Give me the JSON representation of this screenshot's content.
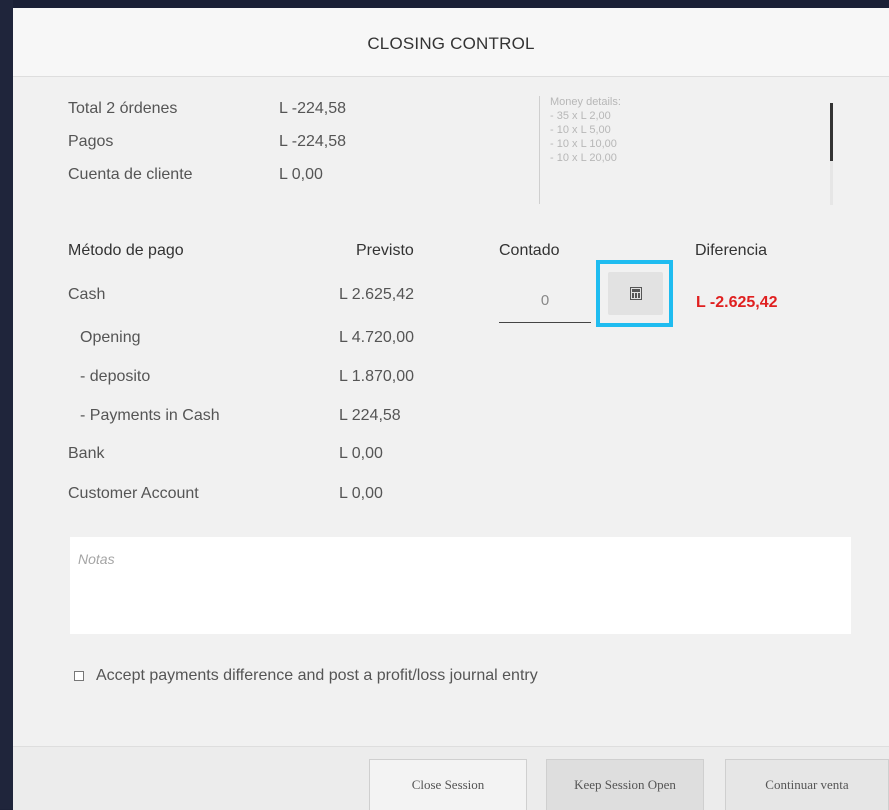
{
  "dialog": {
    "title": "CLOSING CONTROL"
  },
  "summary": [
    {
      "label": "Total 2 órdenes",
      "value": "L -224,58"
    },
    {
      "label": "Pagos",
      "value": "L -224,58"
    },
    {
      "label": "Cuenta de cliente",
      "value": "L 0,00"
    }
  ],
  "money_details": {
    "title": "Money details:",
    "lines": [
      "- 35 x L 2,00",
      "- 10 x L 5,00",
      "- 10 x L 10,00",
      "- 10 x L 20,00"
    ]
  },
  "table": {
    "headers": {
      "method": "Método de pago",
      "expected": "Previsto",
      "counted": "Contado",
      "difference": "Diferencia"
    },
    "rows": [
      {
        "label": "Cash",
        "expected": "L 2.625,42"
      },
      {
        "label": "Opening",
        "expected": "L 4.720,00"
      },
      {
        "label": "- deposito",
        "expected": "L 1.870,00"
      },
      {
        "label": "- Payments in Cash",
        "expected": "L 224,58"
      },
      {
        "label": "Bank",
        "expected": "L 0,00"
      },
      {
        "label": "Customer Account",
        "expected": "L 0,00"
      }
    ],
    "counted_value": "0",
    "difference_value": "L -2.625,42",
    "difference_color": "#e02020"
  },
  "notes": {
    "placeholder": "Notas"
  },
  "accept": {
    "label": "Accept payments difference and post a profit/loss journal entry",
    "checked": false
  },
  "buttons": {
    "close_session": "Close Session",
    "keep_open": "Keep Session Open",
    "continue": "Continuar venta"
  },
  "icons": {
    "calculator": "calculator-icon"
  },
  "colors": {
    "highlight": "#1fbcf0",
    "backdrop": "#1c2238"
  }
}
